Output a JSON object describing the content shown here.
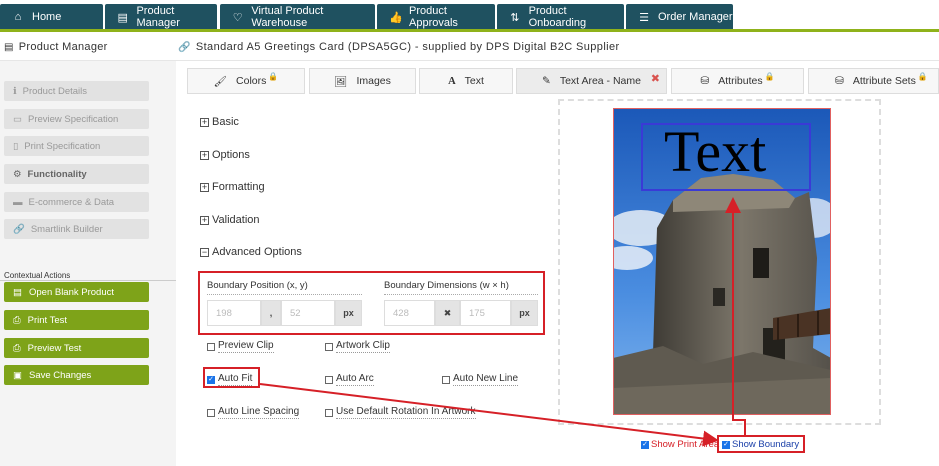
{
  "nav": {
    "tabs": [
      {
        "label": "Home",
        "icon": "home-icon"
      },
      {
        "label": "Product Manager",
        "icon": "document-icon"
      },
      {
        "label": "Virtual Product Warehouse",
        "icon": "heart-icon"
      },
      {
        "label": "Product Approvals",
        "icon": "thumbs-up-icon"
      },
      {
        "label": "Product Onboarding",
        "icon": "sync-icon"
      },
      {
        "label": "Order Manager",
        "icon": "list-icon"
      }
    ],
    "accent_color": "#1f5160",
    "stripe_color": "#8fb21a"
  },
  "header": {
    "section": "Product Manager",
    "product_title": "Standard A5 Greetings Card (DPSA5GC) - supplied by DPS Digital B2C Supplier"
  },
  "sidebar": {
    "items": [
      {
        "label": "Product Details"
      },
      {
        "label": "Preview Specification"
      },
      {
        "label": "Print Specification"
      },
      {
        "label": "Functionality"
      },
      {
        "label": "E-commerce & Data"
      },
      {
        "label": "Smartlink Builder"
      }
    ],
    "contextual_label": "Contextual Actions",
    "actions": [
      {
        "label": "Open Blank Product"
      },
      {
        "label": "Print Test"
      },
      {
        "label": "Preview Test"
      },
      {
        "label": "Save Changes"
      }
    ],
    "action_color": "#7ea319"
  },
  "tabs": [
    {
      "label": "Colors"
    },
    {
      "label": "Images"
    },
    {
      "label": "Text"
    },
    {
      "label": "Text Area - Name"
    },
    {
      "label": "Attributes"
    },
    {
      "label": "Attribute Sets"
    }
  ],
  "accordion": [
    {
      "label": "Basic"
    },
    {
      "label": "Options"
    },
    {
      "label": "Formatting"
    },
    {
      "label": "Validation"
    },
    {
      "label": "Advanced Options"
    }
  ],
  "boundary": {
    "position_label": "Boundary Position (x, y)",
    "dimensions_label": "Boundary Dimensions (w × h)",
    "x": "198",
    "y": "52",
    "w": "428",
    "h": "175",
    "sep": ",",
    "times": "✖",
    "unit": "px"
  },
  "options": [
    {
      "label": "Preview Clip",
      "checked": false
    },
    {
      "label": "Artwork Clip",
      "checked": false
    },
    {
      "label": "Auto Fit",
      "checked": true
    },
    {
      "label": "Auto Arc",
      "checked": false
    },
    {
      "label": "Auto New Line",
      "checked": false
    },
    {
      "label": "Auto Line Spacing",
      "checked": false
    },
    {
      "label": "Use Default Rotation In Artwork",
      "checked": false
    }
  ],
  "preview": {
    "text": "Text",
    "show_print_area": "Show Print Area",
    "show_boundary": "Show Boundary"
  }
}
